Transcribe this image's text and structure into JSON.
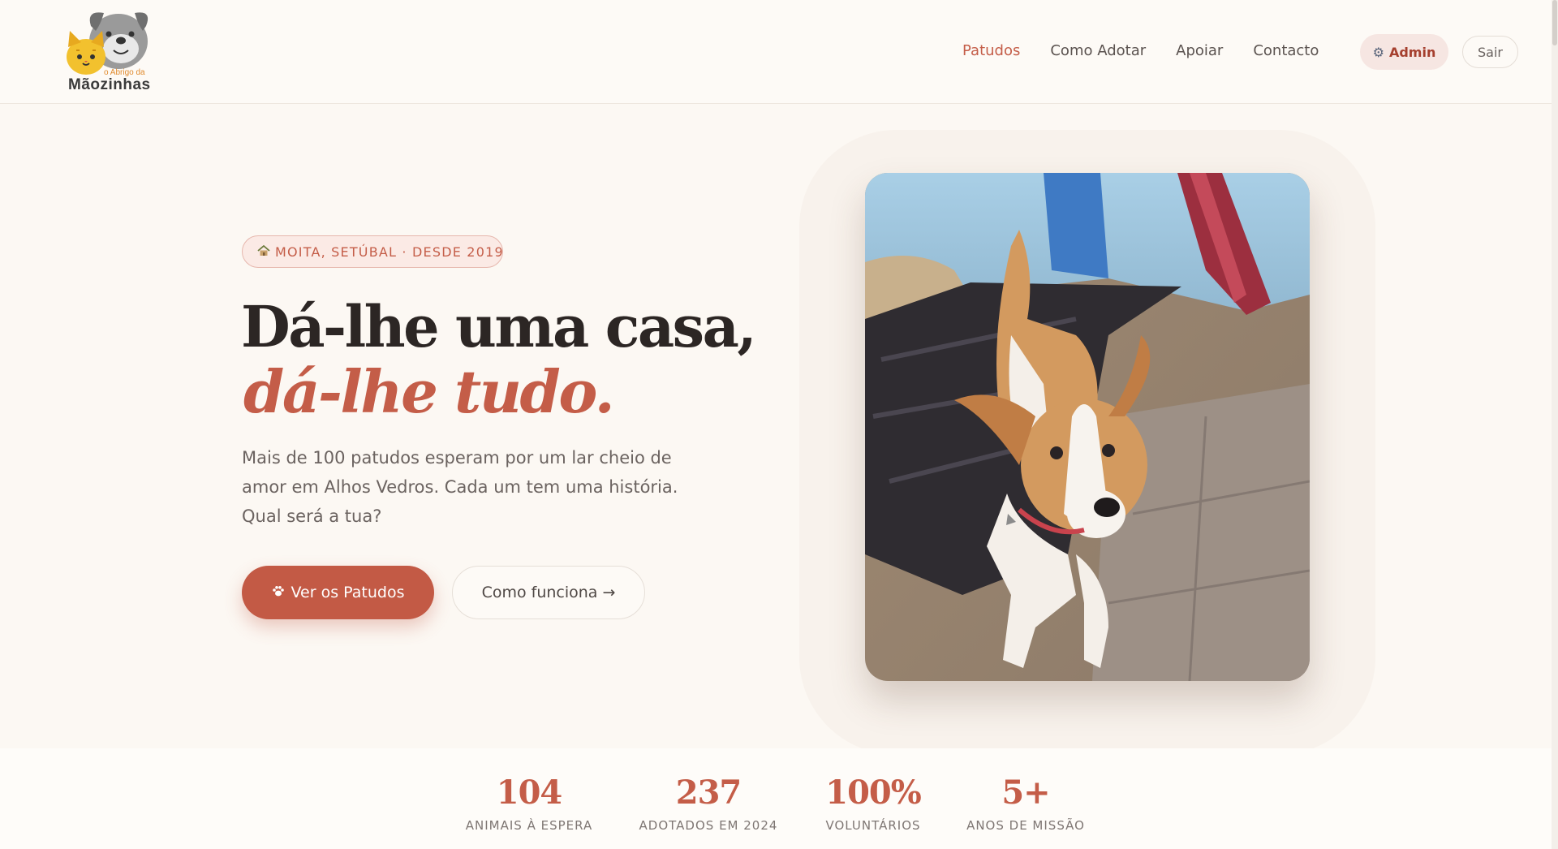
{
  "brand": {
    "logo_small": "o Abrigo da",
    "logo_big": "Mãozinhas"
  },
  "nav": {
    "items": [
      {
        "label": "Patudos",
        "active": true
      },
      {
        "label": "Como Adotar",
        "active": false
      },
      {
        "label": "Apoiar",
        "active": false
      },
      {
        "label": "Contacto",
        "active": false
      }
    ],
    "admin_label": "Admin",
    "logout_label": "Sair"
  },
  "hero": {
    "badge": "MOITA, SETÚBAL · DESDE 2019",
    "title_line1": "Dá-lhe uma casa,",
    "title_line2": "dá-lhe tudo.",
    "lead": "Mais de 100 patudos esperam por um lar cheio de amor em Alhos Vedros. Cada um tem uma história. Qual será a tua?",
    "primary_cta": "Ver os Patudos",
    "secondary_cta": "Como funciona →"
  },
  "stats": [
    {
      "value": "104",
      "label": "ANIMAIS À ESPERA"
    },
    {
      "value": "237",
      "label": "ADOTADOS EM 2024"
    },
    {
      "value": "100%",
      "label": "VOLUNTÁRIOS"
    },
    {
      "value": "5+",
      "label": "ANOS DE MISSÃO"
    }
  ],
  "colors": {
    "accent": "#c45d48",
    "background": "#fcf8f3",
    "text": "#2c2624"
  },
  "icons": {
    "badge_icon": "house-icon",
    "primary_icon": "paw-icon",
    "admin_icon": "gear-icon"
  }
}
